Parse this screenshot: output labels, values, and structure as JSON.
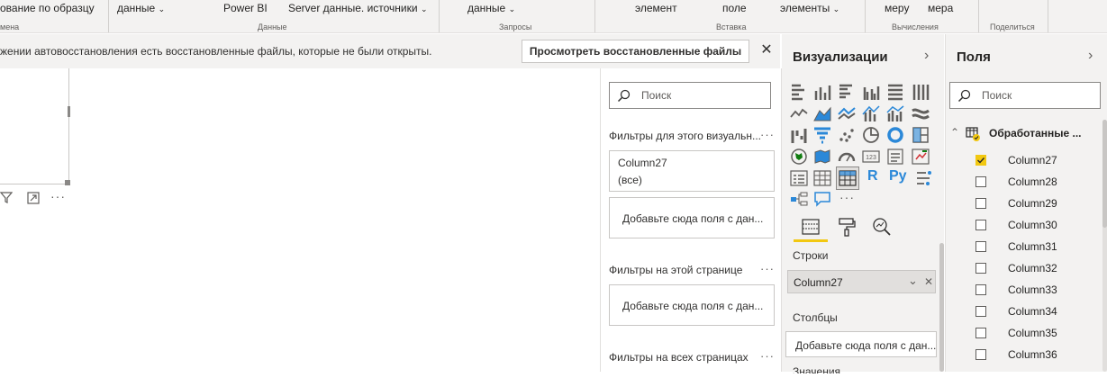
{
  "ribbon": {
    "items": [
      "ование по образцу",
      "данные",
      "Power BI",
      "Server данные. источники",
      "данные",
      "элемент",
      "поле",
      "элементы",
      "меру",
      "мера"
    ],
    "groups": [
      "мена",
      "Данные",
      "Запросы",
      "Вставка",
      "Вычисления",
      "Поделиться"
    ]
  },
  "infobar": {
    "message": "жении автовосстановления есть восстановленные файлы, которые не были открыты.",
    "button": "Просмотреть восстановленные файлы",
    "close": "✕"
  },
  "filters": {
    "search_placeholder": "Поиск",
    "visual_title": "Фильтры для этого визуальн...",
    "card1_field": "Column27",
    "card1_value": "(все)",
    "add_field": "Добавьте сюда поля с дан...",
    "page_title": "Фильтры на этой странице",
    "all_title": "Фильтры на всех страницах",
    "more": "···"
  },
  "viz": {
    "title": "Визуализации",
    "r_label": "R",
    "py_label": "Py",
    "more": "···",
    "rows_label": "Строки",
    "row_field": "Column27",
    "cols_label": "Столбцы",
    "add_field": "Добавьте сюда поля с дан...",
    "values_label": "Значения",
    "accent": "#f2c811"
  },
  "fields": {
    "title": "Поля",
    "search_placeholder": "Поиск",
    "table_name": "Обработанные ...",
    "columns": [
      {
        "name": "Column27",
        "checked": true
      },
      {
        "name": "Column28",
        "checked": false
      },
      {
        "name": "Column29",
        "checked": false
      },
      {
        "name": "Column30",
        "checked": false
      },
      {
        "name": "Column31",
        "checked": false
      },
      {
        "name": "Column32",
        "checked": false
      },
      {
        "name": "Column33",
        "checked": false
      },
      {
        "name": "Column34",
        "checked": false
      },
      {
        "name": "Column35",
        "checked": false
      },
      {
        "name": "Column36",
        "checked": false
      }
    ]
  }
}
